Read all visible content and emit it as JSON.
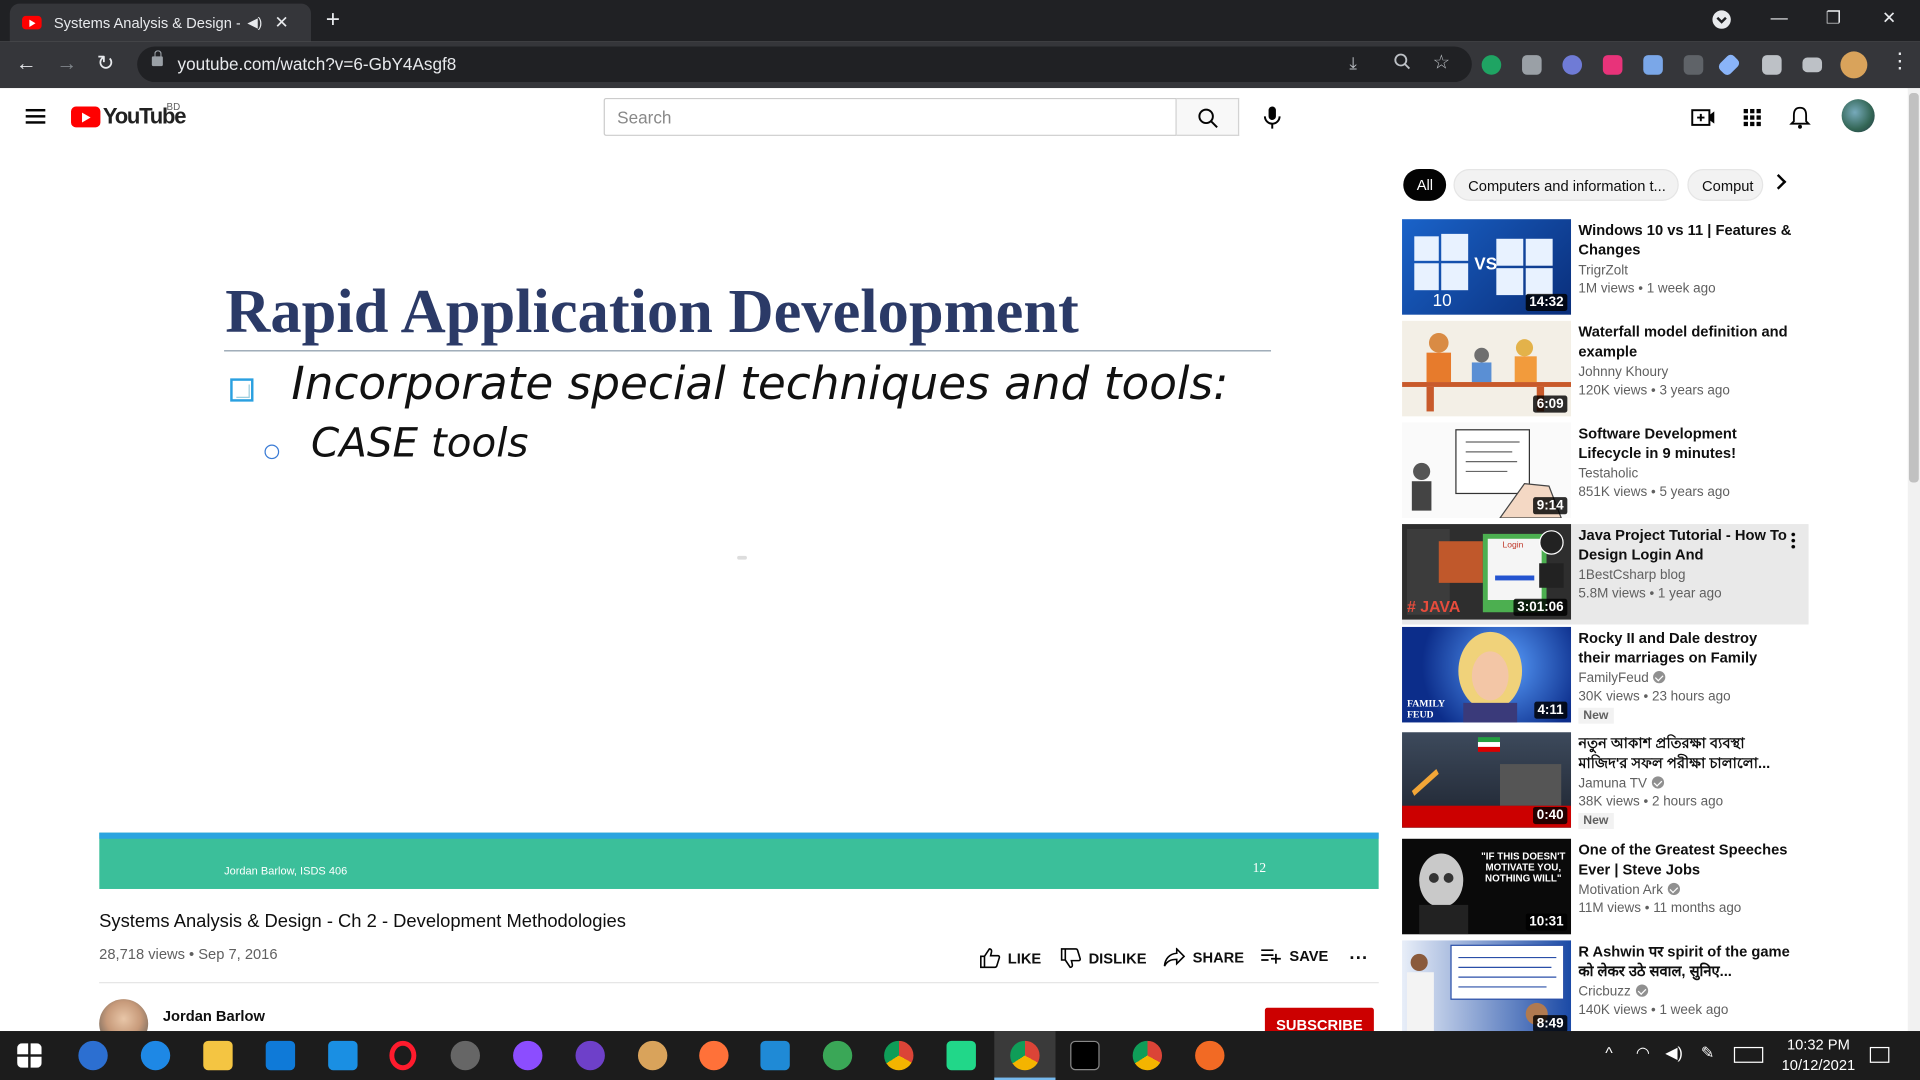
{
  "browser": {
    "tab_title": "Systems Analysis & Design -",
    "new_tab": "+",
    "url": "youtube.com/watch?v=6-GbY4Asgf8"
  },
  "youtube": {
    "logo": "YouTube",
    "region": "BD",
    "search_placeholder": "Search"
  },
  "slide": {
    "title": "Rapid Application Development",
    "bullet": "Incorporate special techniques and tools:",
    "sub_bullet": "CASE tools",
    "footer_left": "Jordan Barlow, ISDS 406",
    "footer_right": "12"
  },
  "video": {
    "title": "Systems Analysis & Design - Ch 2 - Development Methodologies",
    "meta": "28,718 views • Sep 7, 2016",
    "like": "LIKE",
    "dislike": "DISLIKE",
    "share": "SHARE",
    "save": "SAVE",
    "more": "...",
    "channel": "Jordan Barlow",
    "subscribe": "SUBSCRIBE"
  },
  "chips": [
    "All",
    "Computers and information t...",
    "Comput"
  ],
  "related": [
    {
      "title": "Windows 10 vs 11 | Features & Changes",
      "channel": "TrigrZolt",
      "verified": false,
      "views": "1M views • 1 week ago",
      "duration": "14:32",
      "new": ""
    },
    {
      "title": "Waterfall model definition and example",
      "channel": "Johnny Khoury",
      "verified": false,
      "views": "120K views • 3 years ago",
      "duration": "6:09",
      "new": ""
    },
    {
      "title": "Software Development Lifecycle in 9 minutes!",
      "channel": "Testaholic",
      "verified": false,
      "views": "851K views • 5 years ago",
      "duration": "9:14",
      "new": ""
    },
    {
      "title": "Java Project Tutorial - How To Design Login And Dashboard...",
      "channel": "1BestCsharp blog",
      "verified": false,
      "views": "5.8M views • 1 year ago",
      "duration": "3:01:06",
      "new": ""
    },
    {
      "title": "Rocky II and Dale destroy their marriages on Family Feud!",
      "channel": "FamilyFeud",
      "verified": true,
      "views": "30K views • 23 hours ago",
      "duration": "4:11",
      "new": "New"
    },
    {
      "title": "নতুন আকাশ প্রতিরক্ষা ব্যবস্থা মাজিদ'র সফল পরীক্ষা চালালো...",
      "channel": "Jamuna TV",
      "verified": true,
      "views": "38K views • 2 hours ago",
      "duration": "0:40",
      "new": "New"
    },
    {
      "title": "One of the Greatest Speeches Ever | Steve Jobs",
      "channel": "Motivation Ark",
      "verified": true,
      "views": "11M views • 11 months ago",
      "duration": "10:31",
      "new": ""
    },
    {
      "title": "R Ashwin पर spirit of the game को लेकर उठे सवाल, सुनिए...",
      "channel": "Cricbuzz",
      "verified": true,
      "views": "140K views • 1 week ago",
      "duration": "8:49",
      "new": ""
    }
  ],
  "thumb_text": {
    "win_vs": "VS",
    "win_10": "10",
    "java_tag": "# JAVA",
    "java_login": "Login",
    "feud": "FAMILY FEUD",
    "jobs_quote": "\"IF THIS DOESN'T MOTIVATE YOU, NOTHING WILL\""
  },
  "taskbar": {
    "time": "10:32 PM",
    "date": "10/12/2021"
  }
}
